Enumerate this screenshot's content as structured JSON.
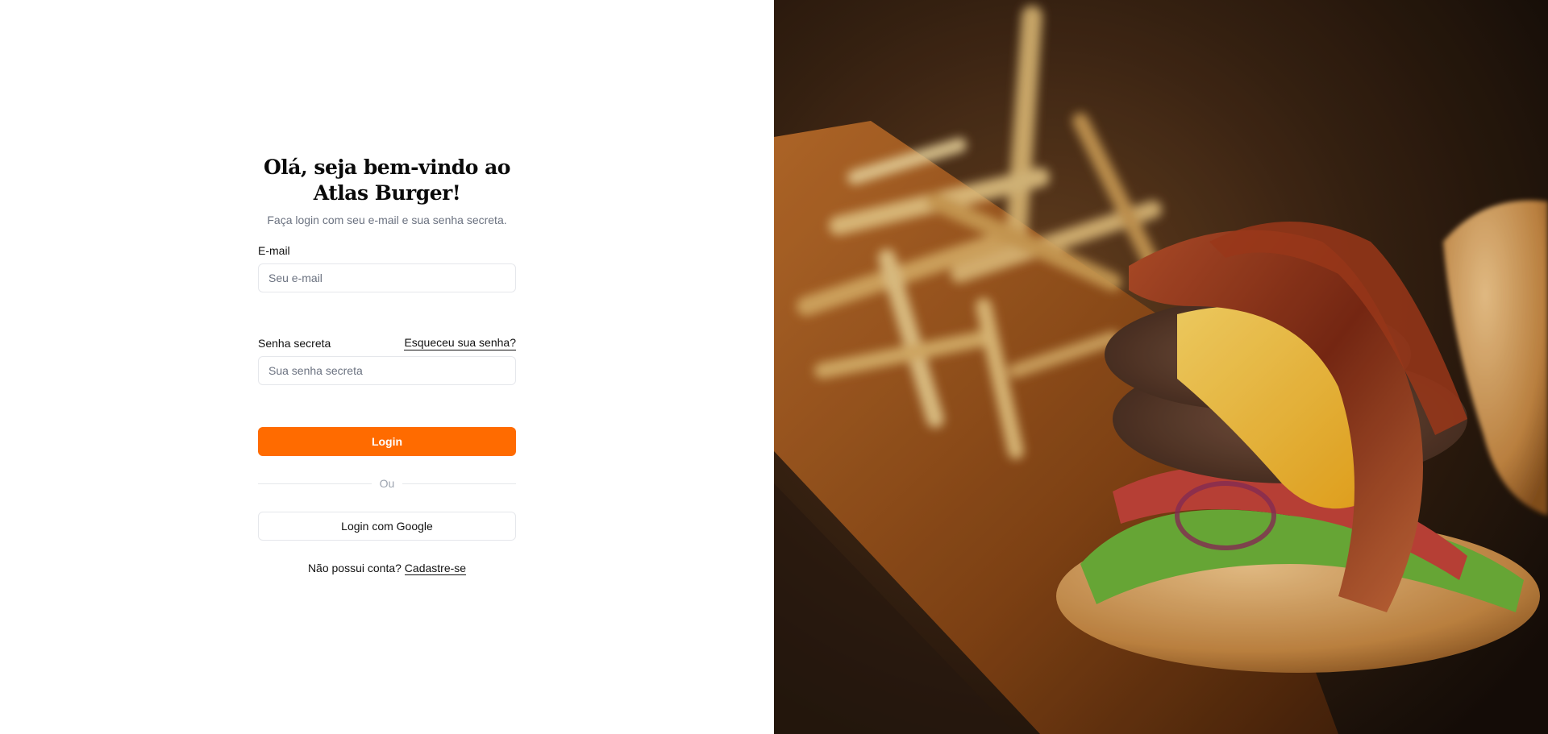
{
  "login": {
    "title": "Olá, seja bem-vindo ao Atlas Burger!",
    "subtitle": "Faça login com seu e-mail e sua senha secreta.",
    "email_label": "E-mail",
    "email_placeholder": "Seu e-mail",
    "password_label": "Senha secreta",
    "forgot_link": "Esqueceu sua senha?",
    "password_placeholder": "Sua senha secreta",
    "login_button": "Login",
    "divider_text": "Ou",
    "google_button": "Login com Google",
    "signup_prompt": "Não possui conta?",
    "signup_link": "Cadastre-se"
  },
  "colors": {
    "accent": "#ff6b00",
    "border": "#e5e7eb",
    "muted_text": "#6b7280"
  },
  "hero": {
    "image": "burger-and-fries-photo"
  }
}
